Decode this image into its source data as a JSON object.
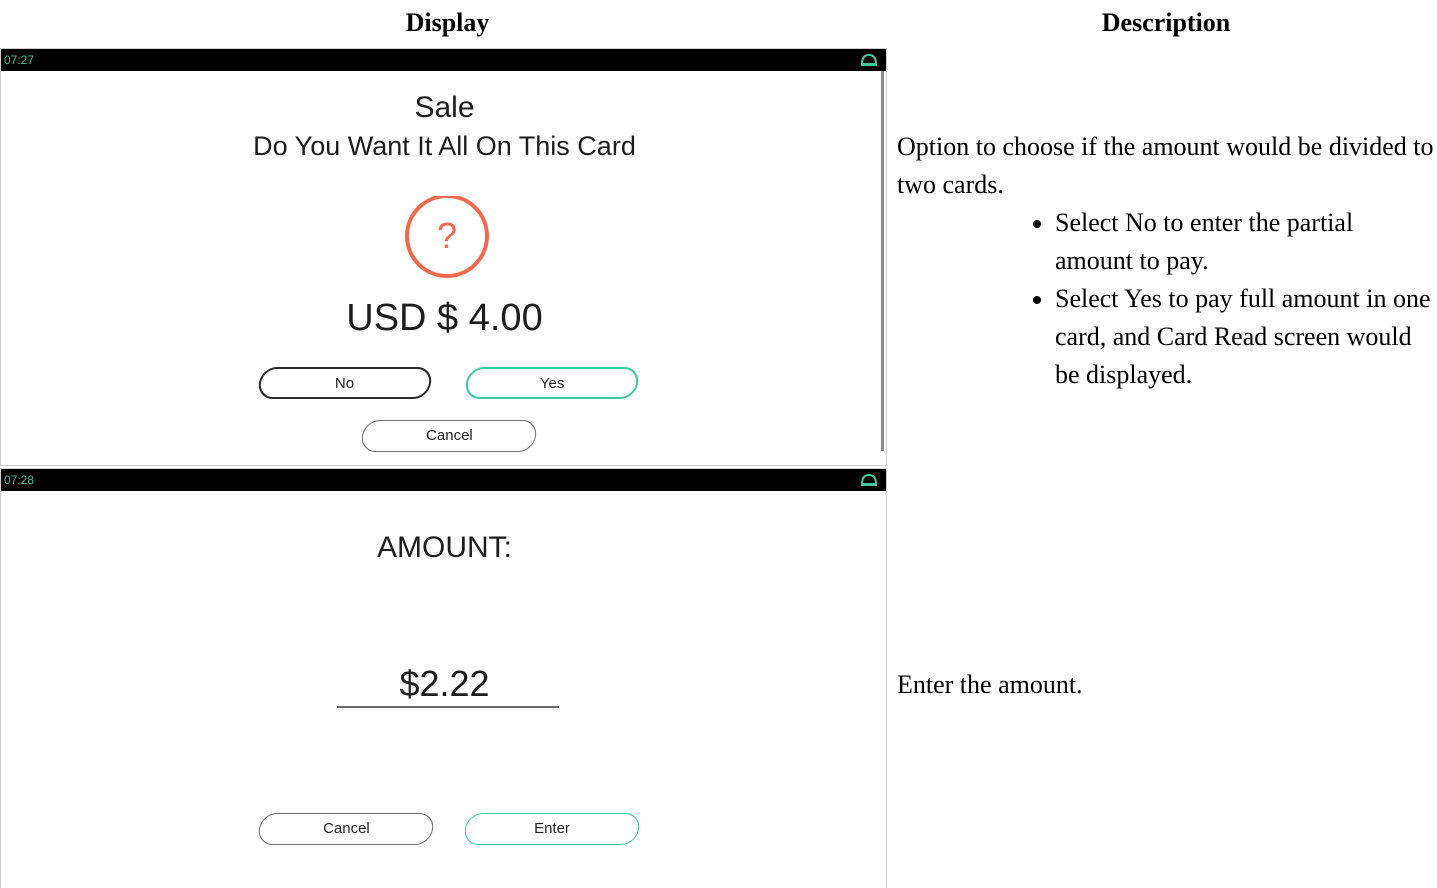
{
  "table": {
    "header_display": "Display",
    "header_description": "Description"
  },
  "screen1": {
    "time": "07:27",
    "title": "Sale",
    "subtitle": "Do You Want It All On This Card",
    "question_mark": "?",
    "amount": "USD $ 4.00",
    "no_label": "No",
    "yes_label": "Yes",
    "cancel_label": "Cancel"
  },
  "screen2": {
    "time": "07:28",
    "title": "AMOUNT:",
    "amount": "$2.22",
    "cancel_label": "Cancel",
    "enter_label": "Enter"
  },
  "descriptions": {
    "row1_intro": "Option to choose if the amount would be divided to two cards.",
    "row1_bullets": [
      "Select No to enter the partial amount to pay.",
      "Select Yes to pay full amount in one card, and Card Read screen would be displayed."
    ],
    "row2": "Enter the amount."
  },
  "colors": {
    "accent_green": "#3fc9a0",
    "question_orange": "#f26a4b",
    "status_bar": "#000000"
  }
}
